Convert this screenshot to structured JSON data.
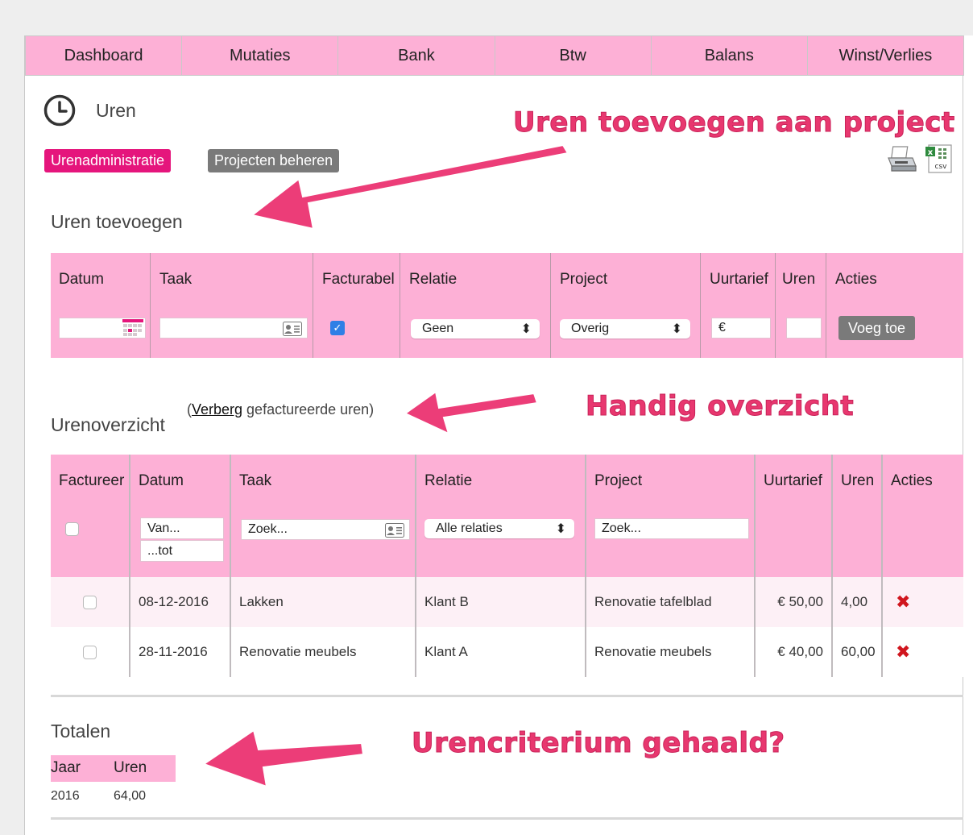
{
  "nav": [
    "Dashboard",
    "Mutaties",
    "Bank",
    "Btw",
    "Balans",
    "Winst/Verlies"
  ],
  "header": {
    "title": "Uren",
    "icon": "clock-icon"
  },
  "tabs": {
    "active": "Urenadministratie",
    "other": "Projecten beheren"
  },
  "annotations": {
    "add_hours": "Uren toevoegen aan project",
    "overview": "Handig overzicht",
    "criterion": "Urencriterium gehaald?"
  },
  "add_section": {
    "title": "Uren toevoegen",
    "columns": [
      "Datum",
      "Taak",
      "Facturabel",
      "Relatie",
      "Project",
      "Uurtarief",
      "Uren",
      "Acties"
    ],
    "relatie_value": "Geen",
    "project_value": "Overig",
    "uurtarief_prefix": "€",
    "facturabel_checked": true,
    "add_button": "Voeg toe"
  },
  "overview": {
    "title": "Urenoverzicht",
    "hide_prefix": "(",
    "hide_link": "Verberg",
    "hide_suffix": " gefactureerde uren)",
    "columns": [
      "Factureer",
      "Datum",
      "Taak",
      "Relatie",
      "Project",
      "Uurtarief",
      "Uren",
      "Acties"
    ],
    "filters": {
      "date_from_placeholder": "Van...",
      "date_to_placeholder": "...tot",
      "task_placeholder": "Zoek...",
      "relation_value": "Alle relaties",
      "project_placeholder": "Zoek..."
    },
    "rows": [
      {
        "datum": "08-12-2016",
        "taak": "Lakken",
        "relatie": "Klant B",
        "project": "Renovatie tafelblad",
        "uurtarief": "€ 50,00",
        "uren": "4,00"
      },
      {
        "datum": "28-11-2016",
        "taak": "Renovatie meubels",
        "relatie": "Klant A",
        "project": "Renovatie meubels",
        "uurtarief": "€ 40,00",
        "uren": "60,00"
      }
    ]
  },
  "totals": {
    "title": "Totalen",
    "columns": [
      "Jaar",
      "Uren"
    ],
    "rows": [
      {
        "jaar": "2016",
        "uren": "64,00"
      }
    ]
  },
  "colors": {
    "pink_band": "#fdb0d6",
    "accent": "#e5157c",
    "annotation": "#e8376f"
  }
}
